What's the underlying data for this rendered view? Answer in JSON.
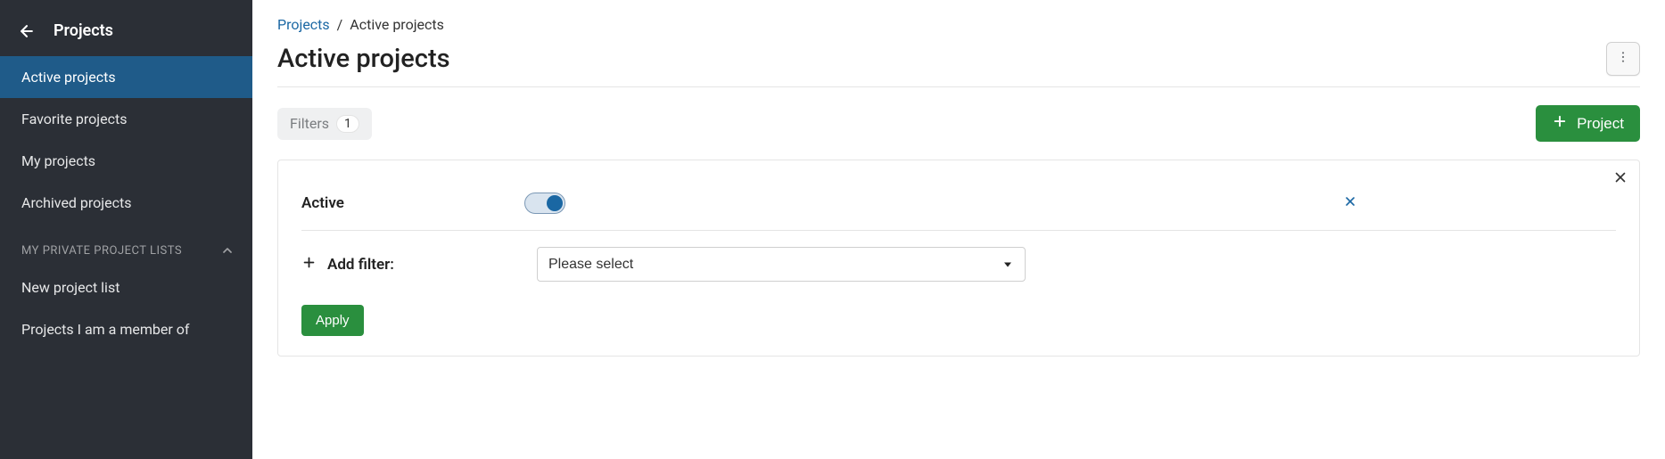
{
  "sidebar": {
    "title": "Projects",
    "items": [
      {
        "label": "Active projects",
        "active": true
      },
      {
        "label": "Favorite projects",
        "active": false
      },
      {
        "label": "My projects",
        "active": false
      },
      {
        "label": "Archived projects",
        "active": false
      }
    ],
    "section_title": "MY PRIVATE PROJECT LISTS",
    "private_lists": [
      {
        "label": "New project list"
      },
      {
        "label": "Projects I am a member of"
      }
    ]
  },
  "breadcrumb": {
    "root": "Projects",
    "separator": "/",
    "current": "Active projects"
  },
  "page_title": "Active projects",
  "toolbar": {
    "filters_label": "Filters",
    "filters_count": "1",
    "project_button": "Project"
  },
  "filters": {
    "rows": [
      {
        "label": "Active",
        "type": "toggle",
        "on": true
      }
    ],
    "add_filter_label": "Add filter:",
    "select_placeholder": "Please select",
    "apply_label": "Apply"
  },
  "colors": {
    "sidebar_bg": "#2b2f36",
    "sidebar_active": "#1f5b89",
    "accent_green": "#2a8f3e",
    "link_blue": "#1a67a3"
  }
}
